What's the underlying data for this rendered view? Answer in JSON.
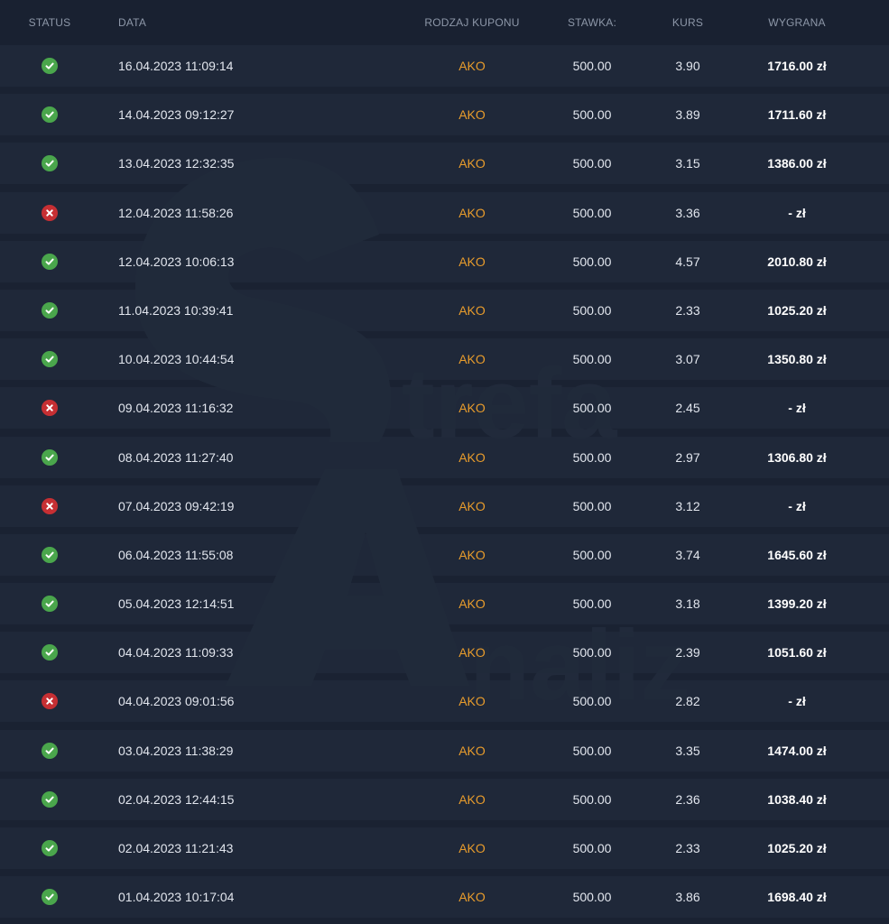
{
  "header": {
    "status": "STATUS",
    "date": "DATA",
    "type": "RODZAJ KUPONU",
    "stake": "STAWKA:",
    "odds": "KURS",
    "win": "WYGRANA"
  },
  "watermark": {
    "text1": "trefa",
    "text2": "naliz"
  },
  "colors": {
    "won": "#4aa64c",
    "lost": "#c62f33",
    "type": "#e89c2c"
  },
  "rows": [
    {
      "status": "won",
      "date": "16.04.2023 11:09:14",
      "type": "AKO",
      "stake": "500.00",
      "odds": "3.90",
      "win": "1716.00 zł"
    },
    {
      "status": "won",
      "date": "14.04.2023 09:12:27",
      "type": "AKO",
      "stake": "500.00",
      "odds": "3.89",
      "win": "1711.60 zł"
    },
    {
      "status": "won",
      "date": "13.04.2023 12:32:35",
      "type": "AKO",
      "stake": "500.00",
      "odds": "3.15",
      "win": "1386.00 zł"
    },
    {
      "status": "lost",
      "date": "12.04.2023 11:58:26",
      "type": "AKO",
      "stake": "500.00",
      "odds": "3.36",
      "win": "- zł"
    },
    {
      "status": "won",
      "date": "12.04.2023 10:06:13",
      "type": "AKO",
      "stake": "500.00",
      "odds": "4.57",
      "win": "2010.80 zł"
    },
    {
      "status": "won",
      "date": "11.04.2023 10:39:41",
      "type": "AKO",
      "stake": "500.00",
      "odds": "2.33",
      "win": "1025.20 zł"
    },
    {
      "status": "won",
      "date": "10.04.2023 10:44:54",
      "type": "AKO",
      "stake": "500.00",
      "odds": "3.07",
      "win": "1350.80 zł"
    },
    {
      "status": "lost",
      "date": "09.04.2023 11:16:32",
      "type": "AKO",
      "stake": "500.00",
      "odds": "2.45",
      "win": "- zł"
    },
    {
      "status": "won",
      "date": "08.04.2023 11:27:40",
      "type": "AKO",
      "stake": "500.00",
      "odds": "2.97",
      "win": "1306.80 zł"
    },
    {
      "status": "lost",
      "date": "07.04.2023 09:42:19",
      "type": "AKO",
      "stake": "500.00",
      "odds": "3.12",
      "win": "- zł"
    },
    {
      "status": "won",
      "date": "06.04.2023 11:55:08",
      "type": "AKO",
      "stake": "500.00",
      "odds": "3.74",
      "win": "1645.60 zł"
    },
    {
      "status": "won",
      "date": "05.04.2023 12:14:51",
      "type": "AKO",
      "stake": "500.00",
      "odds": "3.18",
      "win": "1399.20 zł"
    },
    {
      "status": "won",
      "date": "04.04.2023 11:09:33",
      "type": "AKO",
      "stake": "500.00",
      "odds": "2.39",
      "win": "1051.60 zł"
    },
    {
      "status": "lost",
      "date": "04.04.2023 09:01:56",
      "type": "AKO",
      "stake": "500.00",
      "odds": "2.82",
      "win": "- zł"
    },
    {
      "status": "won",
      "date": "03.04.2023 11:38:29",
      "type": "AKO",
      "stake": "500.00",
      "odds": "3.35",
      "win": "1474.00 zł"
    },
    {
      "status": "won",
      "date": "02.04.2023 12:44:15",
      "type": "AKO",
      "stake": "500.00",
      "odds": "2.36",
      "win": "1038.40 zł"
    },
    {
      "status": "won",
      "date": "02.04.2023 11:21:43",
      "type": "AKO",
      "stake": "500.00",
      "odds": "2.33",
      "win": "1025.20 zł"
    },
    {
      "status": "won",
      "date": "01.04.2023 10:17:04",
      "type": "AKO",
      "stake": "500.00",
      "odds": "3.86",
      "win": "1698.40 zł"
    }
  ]
}
